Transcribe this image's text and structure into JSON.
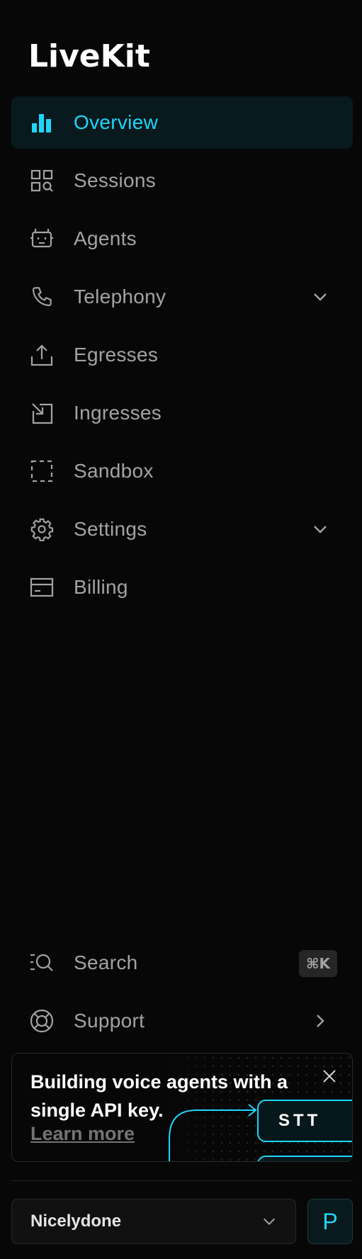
{
  "app": {
    "logo_text": "LiveKit"
  },
  "nav": {
    "items": [
      {
        "label": "Overview",
        "icon": "bar-chart-icon",
        "active": true
      },
      {
        "label": "Sessions",
        "icon": "grid-search-icon"
      },
      {
        "label": "Agents",
        "icon": "robot-icon"
      },
      {
        "label": "Telephony",
        "icon": "phone-icon",
        "expandable": true
      },
      {
        "label": "Egresses",
        "icon": "upload-icon"
      },
      {
        "label": "Ingresses",
        "icon": "download-icon"
      },
      {
        "label": "Sandbox",
        "icon": "dashed-square-icon"
      },
      {
        "label": "Settings",
        "icon": "gear-icon",
        "expandable": true
      },
      {
        "label": "Billing",
        "icon": "credit-card-icon"
      }
    ]
  },
  "bottom": {
    "search_label": "Search",
    "search_shortcut": "⌘K",
    "support_label": "Support"
  },
  "promo": {
    "title": "Building voice agents with a single API key.",
    "link": "Learn more",
    "chip_label": "STT"
  },
  "project": {
    "name": "Nicelydone",
    "avatar_letter": "P"
  },
  "colors": {
    "accent": "#1fd5f9",
    "background": "#070707",
    "active_bg": "#081a1d"
  }
}
